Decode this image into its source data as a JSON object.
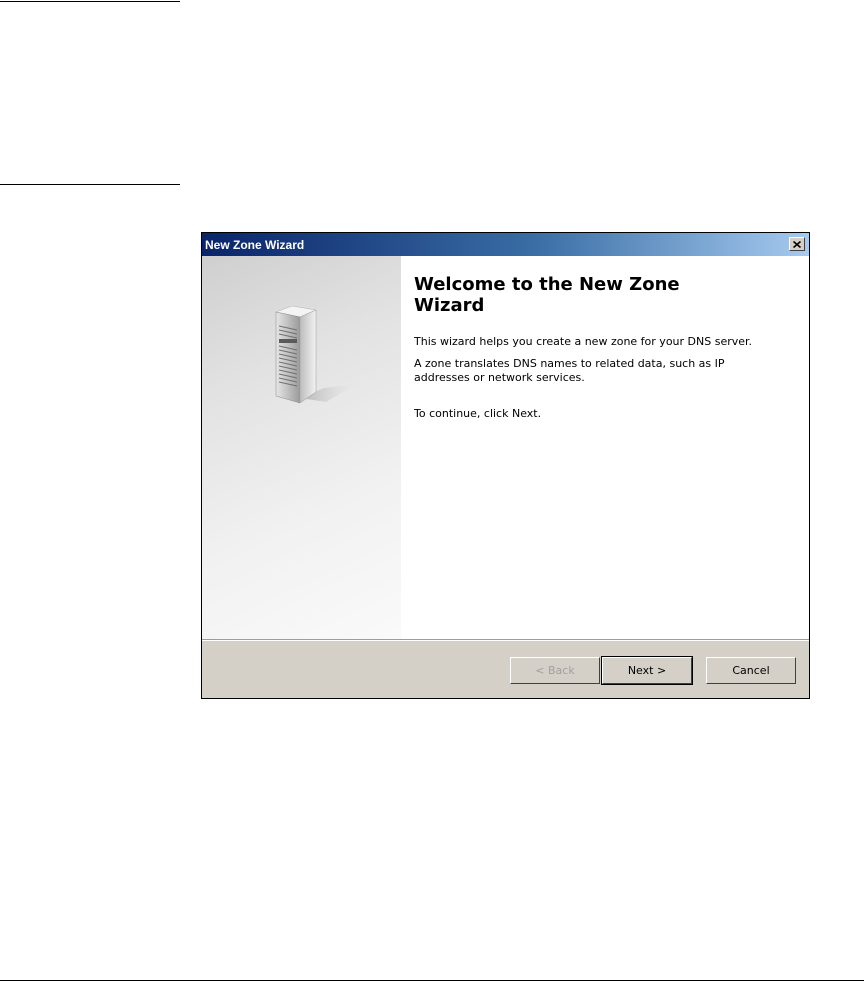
{
  "dialog": {
    "title": "New Zone Wizard",
    "close_glyph": "×",
    "close_icon": "close-icon",
    "illustration_icon": "server-tower-icon",
    "heading": "Welcome to the New Zone Wizard",
    "paragraphs": [
      "This wizard helps you create a new zone for your DNS server.",
      "A zone translates DNS names to related data, such as IP addresses or network services.",
      "To continue, click Next."
    ],
    "buttons": {
      "back": "< Back",
      "next": "Next >",
      "cancel": "Cancel"
    },
    "back_enabled": false
  },
  "colors": {
    "titlebar_start": "#0a246a",
    "titlebar_end": "#a6caf0",
    "dialog_face": "#d4d0c8",
    "disabled_text": "#a0a0a0"
  }
}
